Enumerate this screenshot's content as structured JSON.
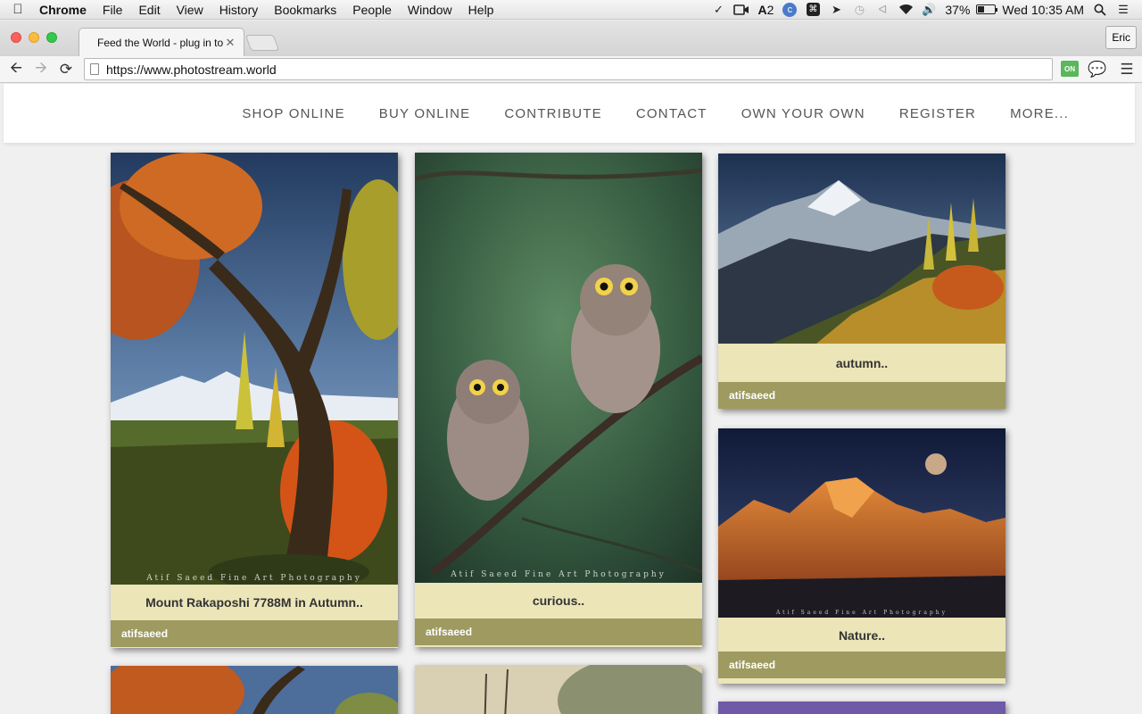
{
  "menubar": {
    "app_name": "Chrome",
    "items": [
      "File",
      "Edit",
      "View",
      "History",
      "Bookmarks",
      "People",
      "Window",
      "Help"
    ],
    "status_count": "2",
    "battery_percent": "37%",
    "battery_level": 0.37,
    "clock": "Wed 10:35 AM"
  },
  "browser": {
    "tab_title": "Feed the World - plug in to",
    "profile_name": "Eric",
    "url": "https://www.photostream.world",
    "ext_on_label": "ON"
  },
  "site": {
    "nav": [
      "SHOP ONLINE",
      "BUY ONLINE",
      "CONTRIBUTE",
      "CONTACT",
      "OWN YOUR OWN",
      "REGISTER",
      "MORE..."
    ]
  },
  "cards": [
    {
      "caption": "Mount Rakaposhi 7788M in Autumn..",
      "author": "atifsaeed",
      "watermark": "Atif Saeed Fine Art Photography"
    },
    {
      "caption": "curious..",
      "author": "atifsaeed",
      "watermark": "Atif Saeed Fine Art Photography"
    },
    {
      "caption": "autumn..",
      "author": "atifsaeed",
      "watermark": ""
    },
    {
      "caption": "Nature..",
      "author": "atifsaeed",
      "watermark": "Atif Saeed Fine Art Photography"
    }
  ]
}
